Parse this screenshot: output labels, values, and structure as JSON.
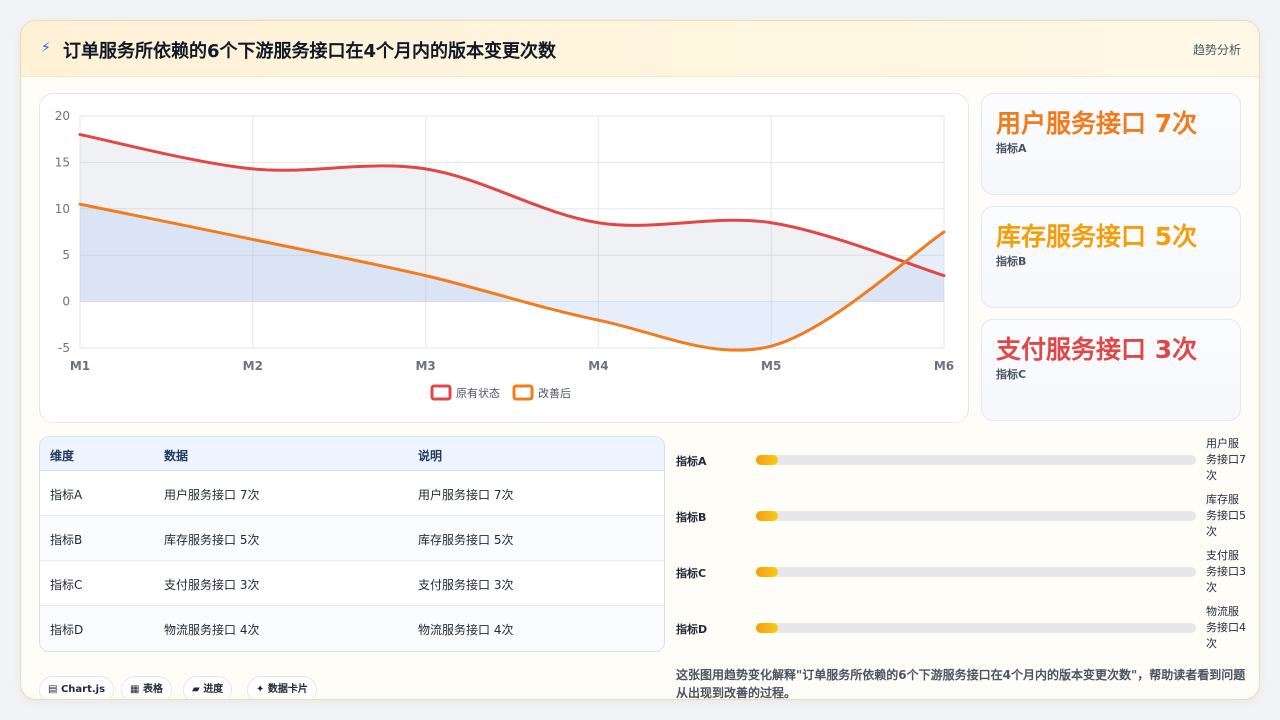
{
  "header": {
    "title": "订单服务所依赖的6个下游服务接口在4个月内的版本变更次数",
    "tag": "趋势分析",
    "icon": "bolt-icon"
  },
  "chart_data": {
    "type": "line",
    "categories": [
      "M1",
      "M2",
      "M3",
      "M4",
      "M5",
      "M6"
    ],
    "ylim": [
      -5,
      20
    ],
    "yticks": [
      -5,
      0,
      5,
      10,
      15,
      20
    ],
    "grid": true,
    "legend_position": "bottom",
    "series": [
      {
        "name": "原有状态",
        "values": [
          18,
          14.3,
          14.3,
          8.5,
          8.5,
          2.8
        ],
        "color": "#e04848",
        "fill": "rgba(180,190,210,0.22)"
      },
      {
        "name": "改善后",
        "values": [
          10.5,
          6.7,
          2.8,
          -2,
          -4.8,
          7.5
        ],
        "color": "#f07c1e",
        "fill": "rgba(170,195,240,0.28)"
      }
    ]
  },
  "stats": [
    {
      "value": "用户服务接口 7次",
      "label": "指标A",
      "color": "#f07c1e"
    },
    {
      "value": "库存服务接口 5次",
      "label": "指标B",
      "color": "#f59e0b"
    },
    {
      "value": "支付服务接口 3次",
      "label": "指标C",
      "color": "#e04848"
    }
  ],
  "table": {
    "headers": [
      "维度",
      "数据",
      "说明"
    ],
    "rows": [
      [
        "指标A",
        "用户服务接口 7次",
        "用户服务接口 7次"
      ],
      [
        "指标B",
        "库存服务接口 5次",
        "库存服务接口 5次"
      ],
      [
        "指标C",
        "支付服务接口 3次",
        "支付服务接口 3次"
      ],
      [
        "指标D",
        "物流服务接口 4次",
        "物流服务接口 4次"
      ]
    ]
  },
  "progress": [
    {
      "label": "指标A",
      "value_text": "用户服务接口7次",
      "fraction": 0.05
    },
    {
      "label": "指标B",
      "value_text": "库存服务接口5次",
      "fraction": 0.05
    },
    {
      "label": "指标C",
      "value_text": "支付服务接口3次",
      "fraction": 0.05
    },
    {
      "label": "指标D",
      "value_text": "物流服务接口4次",
      "fraction": 0.05
    }
  ],
  "description": "这张图用趋势变化解释\"订单服务所依赖的6个下游服务接口在4个月内的版本变更次数\"，帮助读者看到问题从出现到改善的过程。",
  "chips": [
    {
      "icon": "chart-icon",
      "glyph": "▤",
      "label": "Chart.js"
    },
    {
      "icon": "table-icon",
      "glyph": "▦",
      "label": "表格"
    },
    {
      "icon": "folder-icon",
      "glyph": "▰",
      "label": "进度"
    },
    {
      "icon": "sparkle-icon",
      "glyph": "✦",
      "label": "数据卡片"
    }
  ]
}
